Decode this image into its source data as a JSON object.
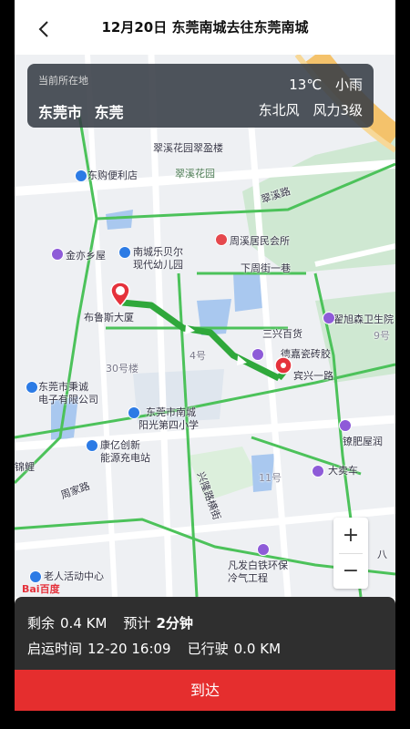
{
  "header": {
    "title": "12月20日 东莞南城去往东莞南城"
  },
  "weather": {
    "location_label": "当前所在地",
    "temperature": "13℃",
    "condition": "小雨",
    "city": "东莞市",
    "district": "东莞",
    "wind_direction": "东北风",
    "wind_level": "风力3级"
  },
  "map": {
    "labels": {
      "cuixi_garden_building": "翠溪花园翠盈楼",
      "cuixi_garden": "翠溪花园",
      "dongfang_store": "东购便利店",
      "jinyi_house": "金亦乡屋",
      "nancheng_kindergarten_1": "南城乐贝尔",
      "nancheng_kindergarten_2": "现代幼儿园",
      "zhouxi_committee": "周溪居民会所",
      "xiazhou_st": "下周街一巷",
      "bulusi": "布鲁斯大厦",
      "sanxing": "三兴百货",
      "dehao": "德嘉瓷砖胶",
      "zhaixu": "翟旭森卫生院",
      "no30": "30号楼",
      "no4": "4号",
      "yanxi_rd": "宾兴一路",
      "chengcheng_1": "东莞市秉诚",
      "chengcheng_2": "电子有限公司",
      "nancheng_school_1": "东莞市南城",
      "nancheng_school_2": "阳光第四小学",
      "kangyi_1": "康亿创新",
      "kangyi_2": "能源充电站",
      "jinli": "锦鲤",
      "gonghao_rd": "周家路",
      "yaofeiwu": "镣肥屋润",
      "dachemaiche": "大卖车",
      "no11": "11号",
      "xingdeng_st": "兴隆路横街",
      "fanfa_1": "凡发白铁环保",
      "fanfa_2": "冷气工程",
      "elder_center": "老人活动中心",
      "no9": "9号",
      "cuixi_rd": "翠溪路",
      "bazi": "八"
    },
    "zoom_in": "+",
    "zoom_out": "−",
    "baidu_logo": "Bai百度"
  },
  "trip": {
    "remaining_label": "剩余",
    "remaining_value": "0.4 KM",
    "eta_label": "预计",
    "eta_value": "2分钟",
    "depart_label": "启运时间",
    "depart_value": "12-20 16:09",
    "driven_label": "已行驶",
    "driven_value": "0.0 KM"
  },
  "actions": {
    "arrive_label": "到达"
  },
  "colors": {
    "accent_red": "#e52e2e",
    "route_green": "#3cb043",
    "panel_dark": "#2f2f2f"
  }
}
